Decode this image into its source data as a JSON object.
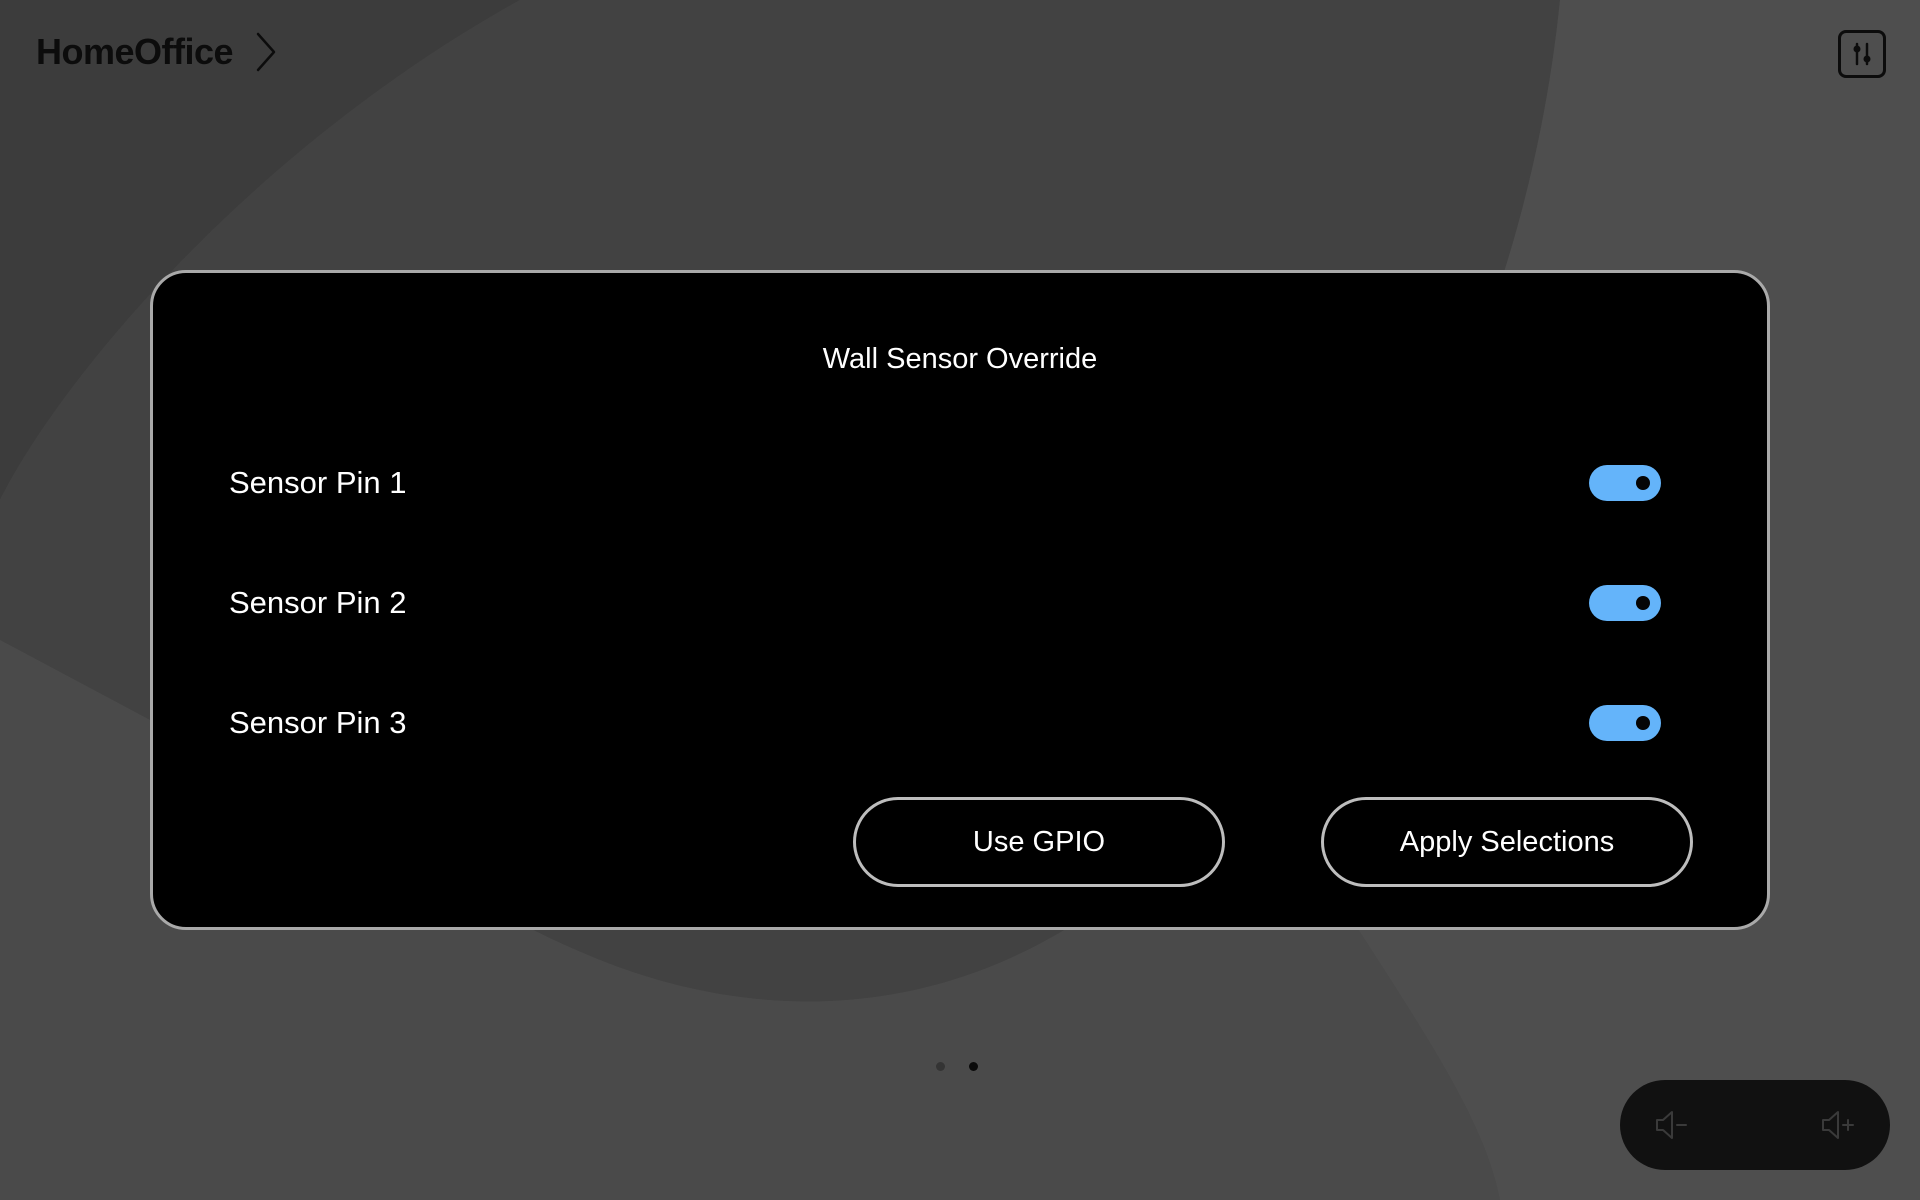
{
  "header": {
    "room_name": "HomeOffice"
  },
  "panel": {
    "title": "Wall Sensor Override",
    "sensors": [
      {
        "label": "Sensor Pin 1",
        "enabled": true
      },
      {
        "label": "Sensor Pin 2",
        "enabled": true
      },
      {
        "label": "Sensor Pin 3",
        "enabled": true
      }
    ],
    "buttons": {
      "use_gpio": "Use GPIO",
      "apply": "Apply Selections"
    }
  },
  "pagination": {
    "total": 2,
    "current": 2
  },
  "icons": {
    "header_chevron": "chevron-right-icon",
    "settings": "settings-sliders-icon",
    "volume_down": "volume-down-icon",
    "volume_up": "volume-up-icon"
  },
  "colors": {
    "toggle_on": "#64b4fa",
    "panel_bg": "#000000",
    "background": "#4a4a4a"
  }
}
